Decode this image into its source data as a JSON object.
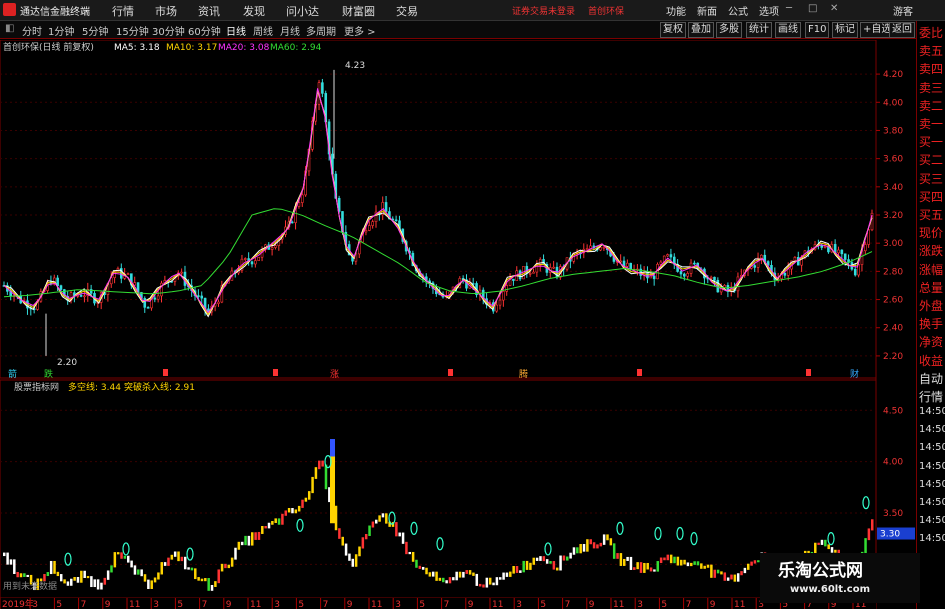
{
  "app": {
    "title": "通达信金融终端"
  },
  "menu": [
    "行情",
    "市场",
    "资讯",
    "发现",
    "问小达",
    "财富圈",
    "交易"
  ],
  "tips": {
    "login": "证券交易未登录",
    "stock": "首创环保"
  },
  "toolbar_right": [
    "功能",
    "新面",
    "公式",
    "选项"
  ],
  "user": "游客",
  "periods": [
    "分时",
    "1分钟",
    "5分钟",
    "15分钟",
    "30分钟",
    "60分钟",
    "日线",
    "周线",
    "月线",
    "多周期",
    "更多 >"
  ],
  "period_active": 6,
  "chart_buttons": [
    "复权",
    "叠加",
    "多股",
    "统计",
    "画线",
    "F10",
    "标记",
    "+自选",
    "返回"
  ],
  "main_legend": {
    "name": "首创环保(日线 前复权)",
    "ma": [
      {
        "label": "MA5: 3.18",
        "color": "#ffffff"
      },
      {
        "label": "MA10: 3.17",
        "color": "#ffd400"
      },
      {
        "label": "MA20: 3.08",
        "color": "#ff33ff"
      },
      {
        "label": "MA60: 2.94",
        "color": "#33dd33"
      }
    ]
  },
  "sub_legend": {
    "name": "股票指标网",
    "items": [
      {
        "label": "多空线: 3.44",
        "color": "#ffd400"
      },
      {
        "label": "突破杀入线: 2.91",
        "color": "#ffd400"
      }
    ]
  },
  "price_axis": [
    "4.20",
    "4.00",
    "3.80",
    "3.60",
    "3.40",
    "3.20",
    "3.00",
    "2.80",
    "2.60",
    "2.40",
    "2.20"
  ],
  "sub_axis": [
    "4.50",
    "4.00",
    "3.50",
    "3.00"
  ],
  "sub_axis_highlight": "3.30",
  "high_label": "4.23",
  "low_label": "2.20",
  "x_axis": [
    "2019年",
    "3",
    "5",
    "7",
    "9",
    "11",
    "3",
    "5",
    "7",
    "9",
    "11",
    "3",
    "5",
    "7",
    "9",
    "11",
    "3",
    "5",
    "7",
    "9",
    "11",
    "3",
    "5",
    "7",
    "9",
    "11",
    "3",
    "5",
    "7",
    "9",
    "11",
    "3",
    "5",
    "7",
    "9",
    "11"
  ],
  "event_marks": [
    {
      "text": "箭",
      "color": "#33ddff"
    },
    {
      "text": "跌",
      "color": "#33dd33"
    },
    {
      "text": "涨",
      "color": "#ff3333"
    },
    {
      "text": "腾",
      "color": "#ffaa33"
    },
    {
      "text": "财",
      "color": "#33aaff"
    }
  ],
  "side_items": [
    "委比",
    "卖五",
    "卖四",
    "卖三",
    "卖二",
    "卖一",
    "买一",
    "买二",
    "买三",
    "买四",
    "买五",
    "现价",
    "涨跌",
    "涨幅",
    "总量",
    "外盘",
    "换手",
    "净资",
    "收益",
    "自动",
    "行情",
    "14:50",
    "14:50",
    "14:50",
    "14:50",
    "14:50",
    "14:50",
    "14:50",
    "14:50"
  ],
  "footer_tip": "用到未来数据",
  "watermark": {
    "line1": "乐淘公式网",
    "line2": "www.60lt.com"
  },
  "chart_data": {
    "type": "line",
    "title": "",
    "ylim": [
      2.1,
      4.3
    ],
    "series": [
      {
        "name": "MA60",
        "values": [
          2.62,
          2.63,
          2.65,
          2.67,
          2.66,
          2.65,
          2.64,
          2.66,
          2.7,
          2.9,
          3.2,
          3.25,
          3.2,
          3.12,
          3.05,
          2.95,
          2.85,
          2.72,
          2.66,
          2.64,
          2.66,
          2.7,
          2.75,
          2.78,
          2.8,
          2.82,
          2.8,
          2.77,
          2.72,
          2.68,
          2.7,
          2.73,
          2.76,
          2.8,
          2.86,
          2.94
        ]
      }
    ],
    "price_series": [
      2.7,
      2.6,
      2.55,
      2.75,
      2.6,
      2.65,
      2.6,
      2.8,
      2.75,
      2.55,
      2.7,
      2.8,
      2.65,
      2.5,
      2.7,
      2.85,
      2.9,
      3.0,
      3.1,
      3.4,
      4.2,
      3.3,
      2.85,
      3.15,
      3.25,
      3.1,
      2.85,
      2.7,
      2.6,
      2.75,
      2.65,
      2.55,
      2.75,
      2.8,
      2.85,
      2.78,
      2.9,
      2.95,
      3.0,
      2.85,
      2.8,
      2.75,
      2.9,
      2.8,
      2.85,
      2.7,
      2.65,
      2.8,
      2.9,
      2.75,
      2.85,
      2.95,
      3.0,
      2.9,
      2.8,
      3.2
    ],
    "sub_series": [
      3.1,
      2.9,
      2.8,
      3.0,
      2.8,
      2.9,
      2.8,
      3.1,
      3.0,
      2.8,
      3.0,
      3.1,
      2.9,
      2.8,
      3.0,
      3.2,
      3.3,
      3.4,
      3.5,
      3.6,
      4.05,
      3.4,
      3.0,
      3.3,
      3.5,
      3.3,
      3.0,
      2.9,
      2.8,
      2.95,
      2.85,
      2.8,
      2.95,
      3.0,
      3.1,
      3.0,
      3.15,
      3.2,
      3.25,
      3.05,
      3.0,
      2.95,
      3.1,
      3.0,
      3.05,
      2.9,
      2.85,
      3.0,
      3.1,
      2.95,
      3.05,
      3.15,
      3.2,
      3.1,
      3.0,
      3.44
    ]
  }
}
